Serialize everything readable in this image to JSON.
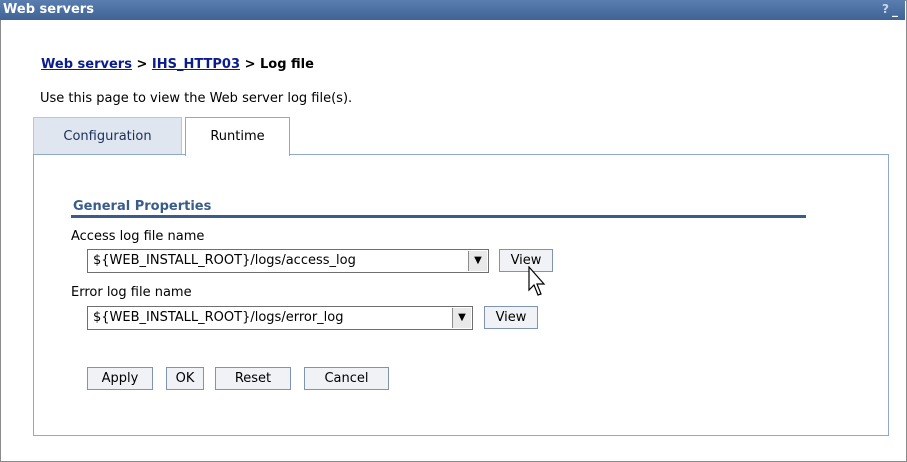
{
  "window": {
    "title": "Web servers",
    "help": "?",
    "minimize": "_"
  },
  "breadcrumb": {
    "items": [
      "Web servers",
      "IHS_HTTP03"
    ],
    "current": "Log file",
    "separator": ">"
  },
  "intro": "Use this page to view the Web server log file(s).",
  "tabs": [
    {
      "label": "Configuration",
      "selected": false
    },
    {
      "label": "Runtime",
      "selected": true
    }
  ],
  "general_properties": {
    "title": "General Properties",
    "access_log": {
      "label": "Access log file name",
      "value": "${WEB_INSTALL_ROOT}/logs/access_log",
      "view_label": "View"
    },
    "error_log": {
      "label": "Error log file name",
      "value": "${WEB_INSTALL_ROOT}/logs/error_log",
      "view_label": "View"
    }
  },
  "buttons": {
    "apply": "Apply",
    "ok": "OK",
    "reset": "Reset",
    "cancel": "Cancel"
  },
  "colors": {
    "titlebar": "#4a6e9e",
    "link": "#0a1c8f",
    "section": "#3a5c8a"
  },
  "icons": {
    "select_arrow": "chevron-down-icon",
    "cursor": "mouse-pointer-icon"
  }
}
